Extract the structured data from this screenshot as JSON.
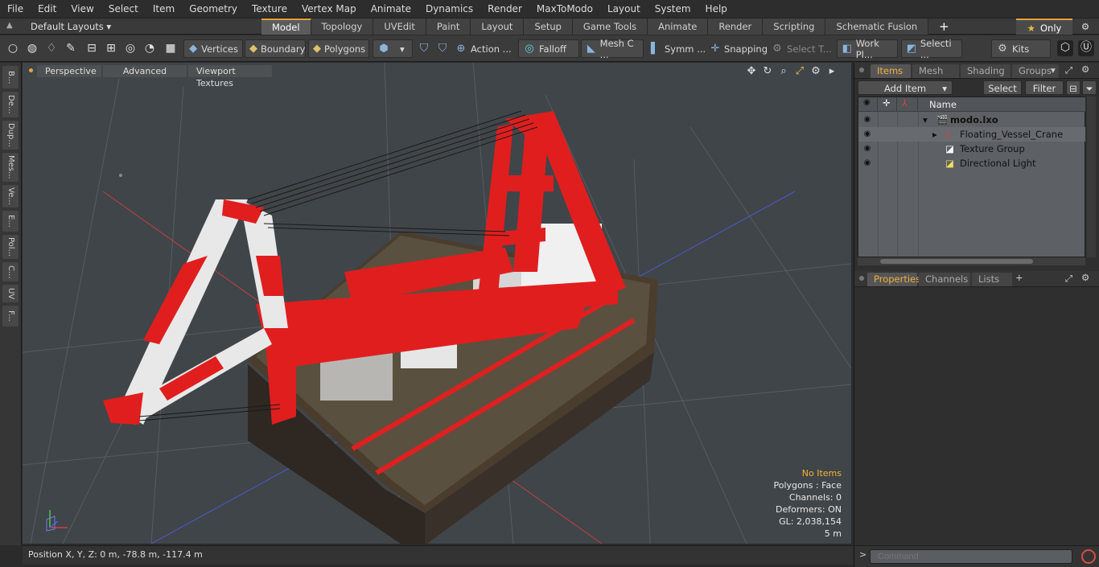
{
  "menu": [
    "File",
    "Edit",
    "View",
    "Select",
    "Item",
    "Geometry",
    "Texture",
    "Vertex Map",
    "Animate",
    "Dynamics",
    "Render",
    "MaxToModo",
    "Layout",
    "System",
    "Help"
  ],
  "layout_dropdown": "Default Layouts",
  "tabs": [
    "Model",
    "Topology",
    "UVEdit",
    "Paint",
    "Layout",
    "Setup",
    "Game Tools",
    "Animate",
    "Render",
    "Scripting",
    "Schematic Fusion"
  ],
  "only_label": "Only",
  "toolbar": {
    "vertices": "Vertices",
    "boundary": "Boundary",
    "polygons": "Polygons",
    "action": "Action ...",
    "falloff": "Falloff",
    "mesh": "Mesh C ...",
    "symm": "Symm ...",
    "snapping": "Snapping",
    "select_t": "Select T...",
    "workpl": "Work Pl...",
    "selecti": "Selecti ...",
    "kits": "Kits"
  },
  "left_tabs": [
    "B...",
    "De...",
    "Dup...",
    "Mes...",
    "Ve...",
    "E...",
    "Pol...",
    "C...",
    "UV",
    "F..."
  ],
  "viewport": {
    "perspective": "Perspective",
    "advanced": "Advanced",
    "textures": "Viewport Textures",
    "info": {
      "no_items": "No Items",
      "polygons": "Polygons : Face",
      "channels": "Channels: 0",
      "deformers": "Deformers: ON",
      "gl": "GL: 2,038,154",
      "scale": "5 m"
    }
  },
  "status": "Position X, Y, Z:   0 m, -78.8 m, -117.4 m",
  "panel": {
    "tabs": [
      "Items",
      "Mesh ...",
      "Shading",
      "Groups"
    ],
    "add_item": "Add Item",
    "select": "Select",
    "filter": "Filter",
    "name_col": "Name",
    "items": [
      {
        "label": "modo.lxo"
      },
      {
        "label": "Floating_Vessel_Crane"
      },
      {
        "label": "Texture Group"
      },
      {
        "label": "Directional Light"
      }
    ],
    "props_tabs": [
      "Properties",
      "Channels",
      "Lists"
    ],
    "command_placeholder": "Command"
  },
  "colors": {
    "accent": "#e6a23c",
    "crane_red": "#e01e1e",
    "viewport_bg": "#404549"
  }
}
